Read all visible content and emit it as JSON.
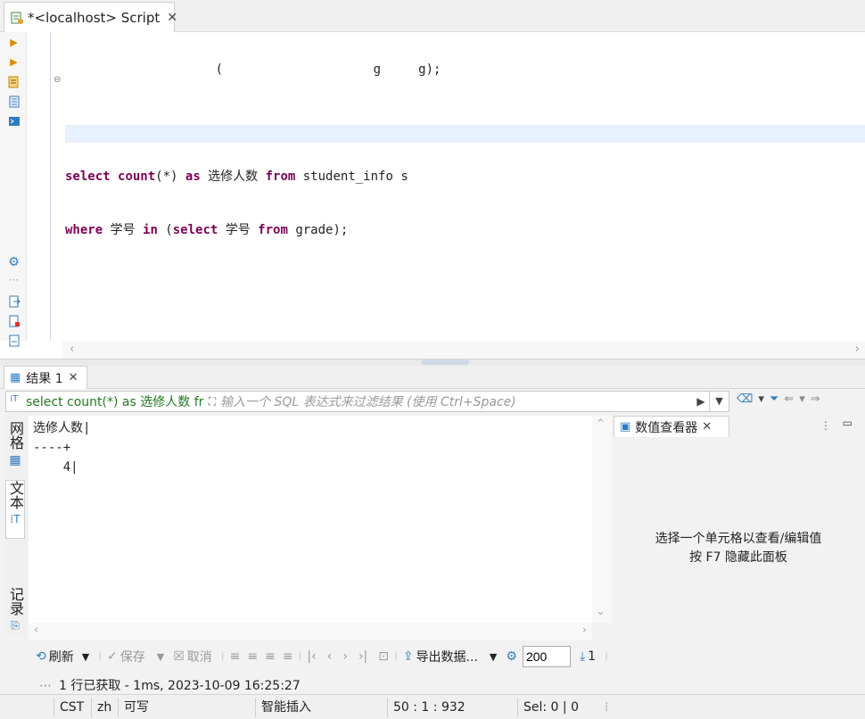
{
  "editor_tab": {
    "title": "*<localhost> Script",
    "close": "✕"
  },
  "code": {
    "line1": [
      {
        "t": "select",
        "k": 1
      },
      {
        "t": " ",
        "k": 0
      },
      {
        "t": "count",
        "k": 1
      },
      {
        "t": "(*) ",
        "k": 0
      },
      {
        "t": "as",
        "k": 1
      },
      {
        "t": " 选修人数 ",
        "k": 0
      },
      {
        "t": "from",
        "k": 1
      },
      {
        "t": " student_info s",
        "k": 0
      }
    ],
    "line2": [
      {
        "t": "where",
        "k": 1
      },
      {
        "t": " 学号 ",
        "k": 0
      },
      {
        "t": "in",
        "k": 1
      },
      {
        "t": " (",
        "k": 0
      },
      {
        "t": "select",
        "k": 1
      },
      {
        "t": " 学号 ",
        "k": 0
      },
      {
        "t": "from",
        "k": 1
      },
      {
        "t": " grade);",
        "k": 0
      }
    ]
  },
  "results_tab": {
    "label": "结果 1",
    "close": "✕"
  },
  "filter": {
    "query": "select count(*) as 选修人数 fror",
    "placeholder": "输入一个 SQL 表达式来过滤结果 (使用 Ctrl+Space)"
  },
  "side_tabs": {
    "grid": "网格",
    "text": "文本",
    "record": "记录"
  },
  "text_result": {
    "header": "选修人数|",
    "divider": "----+",
    "row1": "    4|"
  },
  "value_viewer": {
    "title": "数值查看器",
    "close": "✕",
    "message_line1": "选择一个单元格以查看/编辑值",
    "message_line2": "按 F7 隐藏此面板"
  },
  "toolbar": {
    "refresh": "刷新",
    "save": "保存",
    "cancel": "取消",
    "export": "导出数据...",
    "fetch_size": "200",
    "row_count": "1"
  },
  "info_line": "1 行已获取 - 1ms, 2023-10-09 16:25:27",
  "status": {
    "timezone": "CST",
    "locale": "zh",
    "mode": "可写",
    "insert_mode": "智能插入",
    "position": "50 : 1 : 932",
    "selection": "Sel: 0 | 0"
  }
}
